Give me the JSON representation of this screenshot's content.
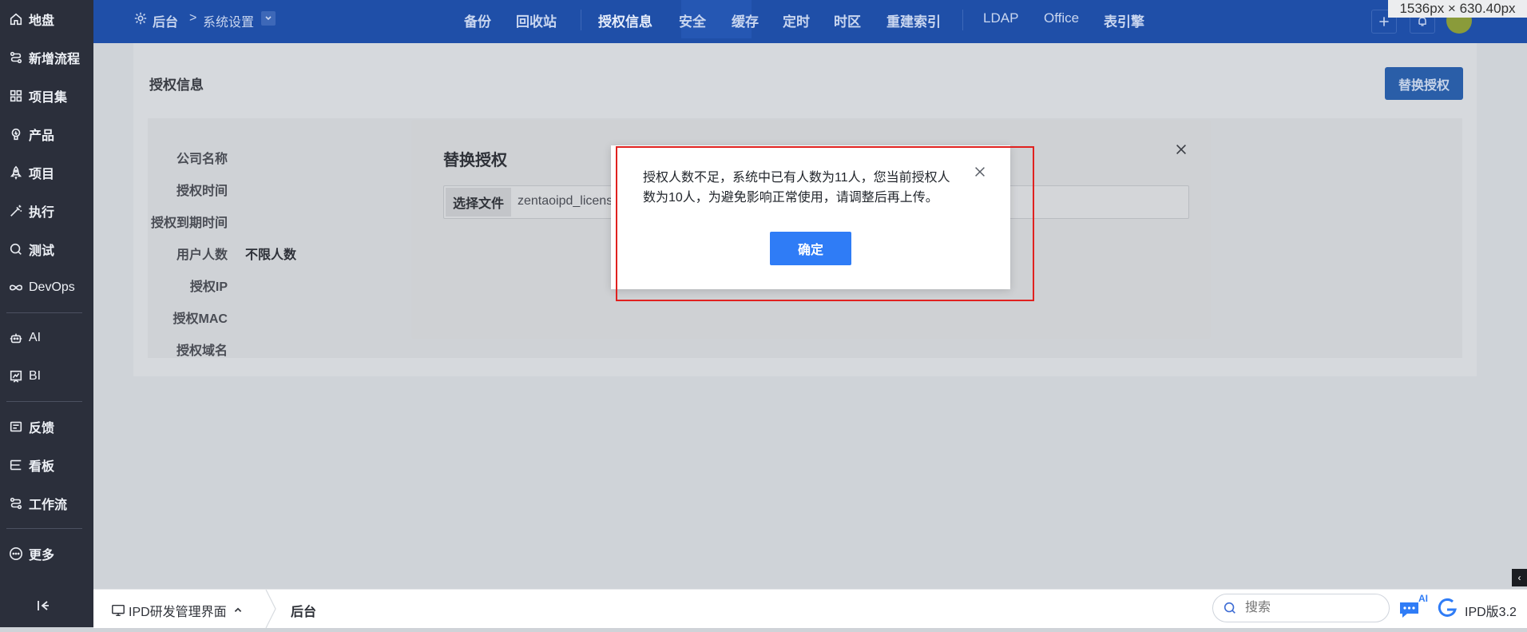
{
  "sidebar": {
    "items": [
      {
        "label": "地盘",
        "icon": "home-icon"
      },
      {
        "label": "新增流程",
        "icon": "flow-icon"
      },
      {
        "label": "项目集",
        "icon": "grid-icon"
      },
      {
        "label": "产品",
        "icon": "lightbulb-icon"
      },
      {
        "label": "项目",
        "icon": "rocket-icon"
      },
      {
        "label": "执行",
        "icon": "wand-icon"
      },
      {
        "label": "测试",
        "icon": "search-icon"
      },
      {
        "label": "DevOps",
        "icon": "infinity-icon"
      },
      {
        "label": "AI",
        "icon": "robot-icon"
      },
      {
        "label": "BI",
        "icon": "chart-icon"
      },
      {
        "label": "反馈",
        "icon": "feedback-icon"
      },
      {
        "label": "看板",
        "icon": "kanban-icon"
      },
      {
        "label": "工作流",
        "icon": "workflow-icon"
      },
      {
        "label": "更多",
        "icon": "more-icon"
      }
    ]
  },
  "topbar": {
    "breadcrumb": {
      "root": "后台",
      "current": "系统设置"
    },
    "nav": [
      "备份",
      "回收站",
      "授权信息",
      "安全",
      "缓存",
      "定时",
      "时区",
      "重建索引",
      "LDAP",
      "Office",
      "表引擎"
    ],
    "active_nav": "授权信息"
  },
  "size_tag": "1536px × 630.40px",
  "license_page": {
    "title": "授权信息",
    "replace_button": "替换授权",
    "fields": [
      {
        "label": "公司名称",
        "value": ""
      },
      {
        "label": "授权时间",
        "value": ""
      },
      {
        "label": "授权到期时间",
        "value": ""
      },
      {
        "label": "用户人数",
        "value": "不限人数"
      },
      {
        "label": "授权IP",
        "value": ""
      },
      {
        "label": "授权MAC",
        "value": ""
      },
      {
        "label": "授权域名",
        "value": ""
      }
    ]
  },
  "replace_modal": {
    "title": "替换授权",
    "choose_file": "选择文件",
    "file_name": "zentaoipd_licens"
  },
  "alert": {
    "message": "授权人数不足，系统中已有人数为11人，您当前授权人数为10人，为避免影响正常使用，请调整后再上传。",
    "ok_label": "确定"
  },
  "bottombar": {
    "app_switch": "IPD研发管理界面",
    "crumb": "后台",
    "search_placeholder": "搜索",
    "ai_badge": "AI",
    "version": "IPD版3.2"
  },
  "colors": {
    "sidebar_bg": "#2b2f3b",
    "topbar_bg": "#1f4fa8",
    "primary": "#2f7cf6",
    "highlight": "#e0211f"
  }
}
